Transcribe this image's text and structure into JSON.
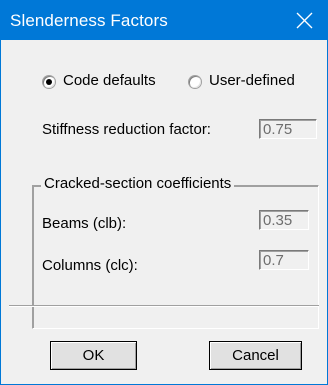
{
  "window": {
    "title": "Slenderness Factors",
    "accent_color": "#0078d7"
  },
  "mode": {
    "selected": "code_defaults",
    "code_defaults_label": "Code defaults",
    "user_defined_label": "User-defined"
  },
  "stiffness": {
    "label": "Stiffness reduction factor:",
    "value": "0.75"
  },
  "cracked": {
    "legend": "Cracked-section coefficients",
    "beams_label": "Beams (clb):",
    "beams_value": "0.35",
    "columns_label": "Columns (clc):",
    "columns_value": "0.7"
  },
  "buttons": {
    "ok_label": "OK",
    "cancel_label": "Cancel"
  },
  "icons": {
    "close": "close-icon"
  }
}
